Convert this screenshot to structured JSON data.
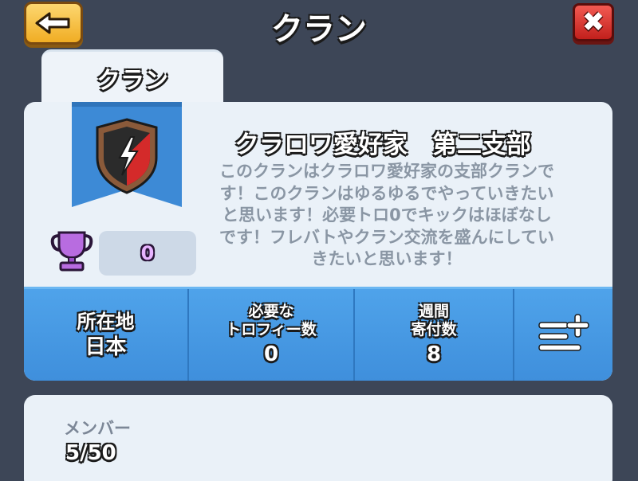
{
  "header": {
    "title": "クラン",
    "back_icon": "back-arrow-icon",
    "close_icon": "close-icon",
    "close_glyph": "✖",
    "back_color": "#f4b532",
    "close_color": "#d9302b"
  },
  "tabs": [
    {
      "label": "クラン",
      "active": true
    }
  ],
  "clan": {
    "name": "クラロワ愛好家　第二支部",
    "description": "このクランはクラロワ愛好家の支部クランです！このクランはゆるゆるでやっていきたいと思います！必要トロ0でキックはほぼなしです！フレバトやクラン交流を盛んにしていきたいと思います！",
    "trophies": "0",
    "badge_icon": "lightning-shield-badge-icon",
    "trophy_icon": "trophy-icon",
    "banner_color": "#3d8ad6"
  },
  "stats": {
    "location_label": "所在地",
    "location_value": "日本",
    "required_trophies_label": "必要な\nトロフィー数",
    "required_trophies_value": "0",
    "weekly_donations_label": "週間\n寄付数",
    "weekly_donations_value": "8",
    "menu_icon": "menu-add-icon",
    "bar_color": "#4a9be6"
  },
  "members": {
    "label": "メンバー",
    "count": "5/50"
  }
}
